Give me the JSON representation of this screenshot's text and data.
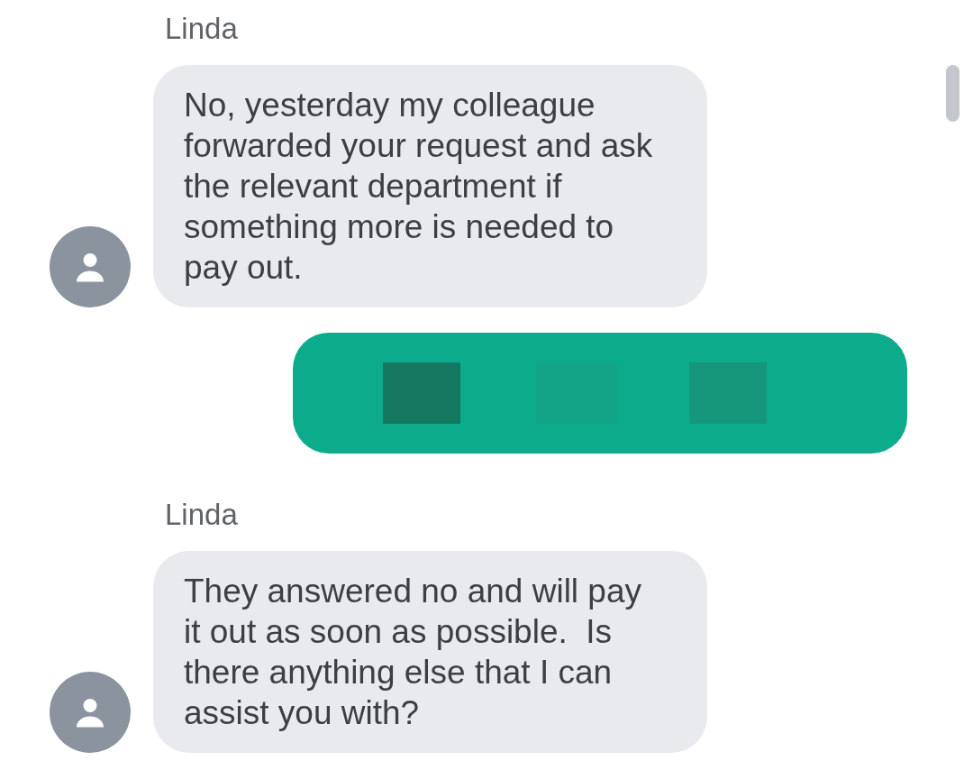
{
  "messages": [
    {
      "kind": "incoming",
      "sender": "Linda",
      "text": "No, yesterday my colleague forwarded your request and ask the relevant department if something more is needed to pay out."
    },
    {
      "kind": "outgoing",
      "redacted": true
    },
    {
      "kind": "incoming",
      "sender": "Linda",
      "text": "They answered no and will pay it out as soon as possible.  Is there anything else that I can assist you with?"
    }
  ]
}
